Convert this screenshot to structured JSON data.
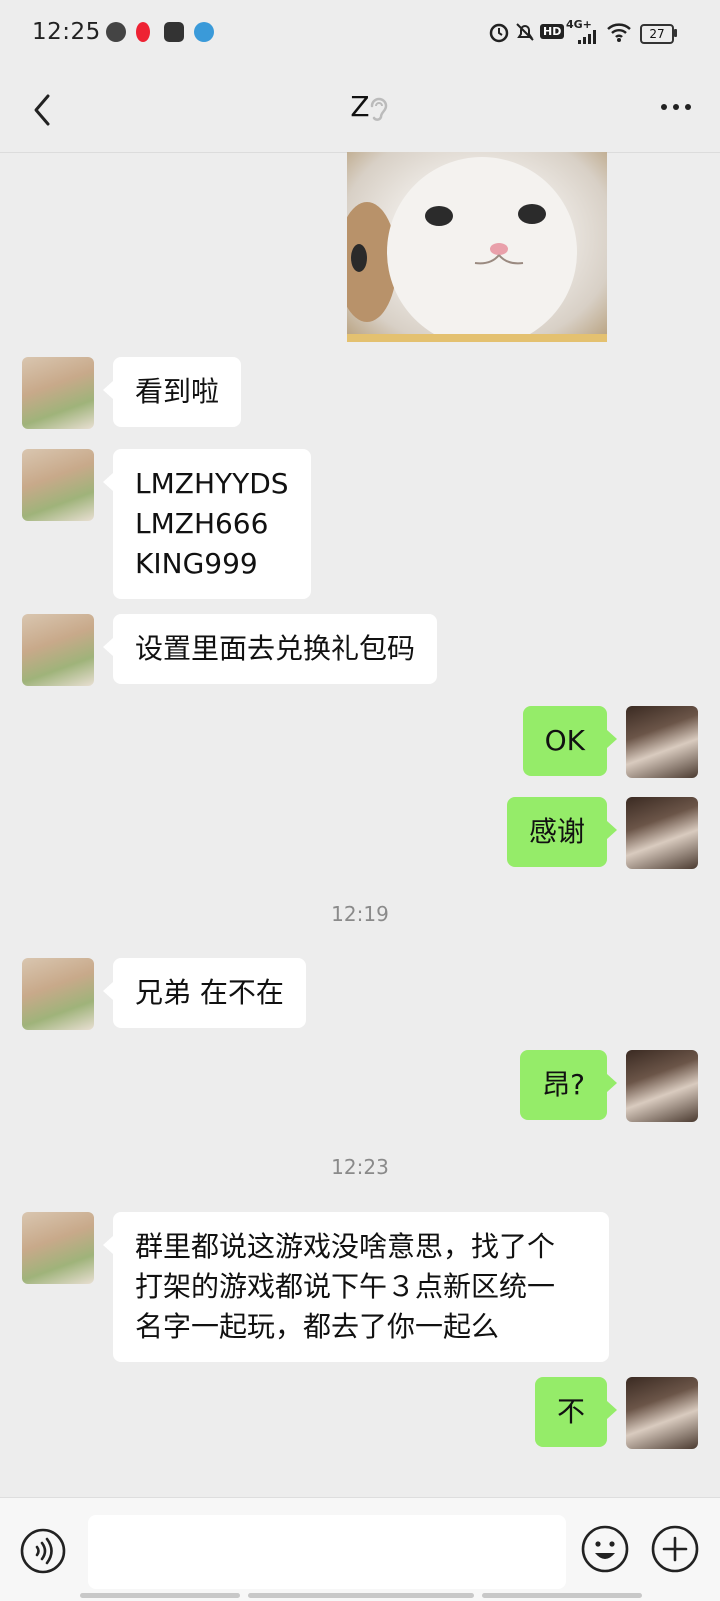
{
  "status_bar": {
    "time": "12:25",
    "network": "4G+",
    "hd": "HD",
    "battery": "27"
  },
  "header": {
    "title": "Z"
  },
  "messages": [
    {
      "side": "in",
      "text": "看到啦"
    },
    {
      "side": "in",
      "text": "LMZHYYDS\nLMZH666\nKING999"
    },
    {
      "side": "in",
      "text": "设置里面去兑换礼包码"
    },
    {
      "side": "out",
      "text": "OK"
    },
    {
      "side": "out",
      "text": "感谢"
    },
    {
      "side": "in",
      "text": "兄弟 在不在"
    },
    {
      "side": "out",
      "text": "昂?"
    },
    {
      "side": "in",
      "text": "群里都说这游戏没啥意思，找了个\n打架的游戏都说下午３点新区统一\n名字一起玩，都去了你一起么"
    },
    {
      "side": "out",
      "text": "不"
    }
  ],
  "timestamps": [
    "12:19",
    "12:23"
  ],
  "colors": {
    "chat_background": "#ededed",
    "incoming_bubble": "#ffffff",
    "outgoing_bubble": "#95ec69"
  },
  "icons": {
    "back": "chevron-left-icon",
    "ear": "ear-icon",
    "more": "ellipsis-icon",
    "voice": "voice-icon",
    "emoji": "emoji-icon",
    "plus": "plus-icon"
  }
}
